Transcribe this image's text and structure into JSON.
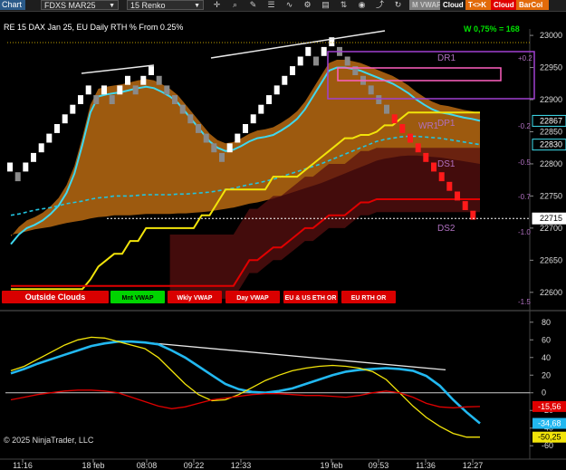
{
  "toolbar": {
    "chart_label": "Chart",
    "instrument": "FDXS MAR25",
    "interval": "15 Renko",
    "chips": [
      {
        "label": "M VWAP",
        "bg": "#7f7f7f",
        "fg": "#c8c8c8"
      },
      {
        "label": "Cloud",
        "bg": "#1e1e1e",
        "fg": "#ffffff"
      },
      {
        "label": "T<>K",
        "bg": "#e26b0a",
        "fg": "#ffffff"
      },
      {
        "label": "Cloud",
        "bg": "#e00000",
        "fg": "#ffffff"
      },
      {
        "label": "BarCol",
        "bg": "#e26b0a",
        "fg": "#ffffff"
      }
    ]
  },
  "header": {
    "title": "RE 15 DAX Jan 25, EU Daily RTH % From 0.25%",
    "wvalue": "W 0,75% = 168"
  },
  "copyright": "© 2025 NinjaTrader, LLC",
  "buttons": [
    {
      "label": "Outside Clouds",
      "color": "#d90000"
    },
    {
      "label": "Mnt VWAP",
      "color": "#00d400"
    },
    {
      "label": "Wkly VWAP",
      "color": "#d90000"
    },
    {
      "label": "Day VWAP",
      "color": "#d90000"
    },
    {
      "label": "EU & US ETH OR",
      "color": "#d90000"
    },
    {
      "label": "EU RTH OR",
      "color": "#d90000"
    }
  ],
  "zone_labels": [
    "DR1",
    "DP1",
    "WR1",
    "DS1",
    "DS2"
  ],
  "pct_labels": [
    "+0.2",
    "-0.2",
    "-0.5",
    "-0.7",
    "-1.0",
    "-1.5"
  ],
  "chart_data": [
    {
      "type": "line",
      "panel": "price",
      "y_ticks": [
        23000,
        22950,
        22900,
        22850,
        22800,
        22750,
        22700,
        22650,
        22600
      ],
      "ylim": [
        22580,
        23010
      ],
      "price_markers": [
        {
          "value": 22867,
          "label": "22867",
          "color": "#40e0f0"
        },
        {
          "value": 22830,
          "label": "22830",
          "color": "#40e0f0"
        },
        {
          "value": 22715,
          "label": "22715",
          "color": "#ffffff"
        }
      ],
      "bricks_up": [
        22795,
        22780,
        22795,
        22810,
        22825,
        22840,
        22855,
        22870,
        22885,
        22900,
        22915,
        22900,
        22915,
        22900,
        22915,
        22930,
        22915,
        22930,
        22945,
        22930,
        22915,
        22900,
        22885,
        22870,
        22855,
        22840,
        22825,
        22810,
        22825,
        22840,
        22855,
        22870,
        22885,
        22900,
        22915,
        22930,
        22945,
        22960,
        22975,
        22960,
        22975,
        22990,
        22975,
        22960,
        22945,
        22930,
        22915,
        22900,
        22885,
        22870,
        22855,
        22840,
        22825,
        22810,
        22795,
        22780,
        22765,
        22750,
        22735,
        22720
      ],
      "series": [
        {
          "name": "",
          "color": "#3fd8ee",
          "values": [
            22675,
            22690,
            22700,
            22705,
            22712,
            22722,
            22735,
            22755,
            22785,
            22830,
            22880,
            22905,
            22908,
            22910,
            22912,
            22915,
            22918,
            22920,
            22918,
            22912,
            22905,
            22895,
            22880,
            22865,
            22850,
            22835,
            22825,
            22820,
            22822,
            22828,
            22835,
            22840,
            22842,
            22845,
            22852,
            22860,
            22870,
            22885,
            22905,
            22925,
            22945,
            22950,
            22950,
            22948,
            22945,
            22940,
            22935,
            22930,
            22925,
            22918,
            22910,
            22900,
            22892,
            22885,
            22880,
            22878,
            22875,
            22872,
            22870,
            22867
          ]
        },
        {
          "name": "",
          "color": "#22c4e0",
          "values": [
            22720,
            22722,
            22725,
            22728,
            22730,
            22732,
            22735,
            22738,
            22740,
            22742,
            22745,
            22747,
            22748,
            22750,
            22750,
            22750,
            22751,
            22752,
            22752,
            22752,
            22752,
            22753,
            22753,
            22754,
            22755,
            22756,
            22758,
            22760,
            22762,
            22765,
            22768,
            22770,
            22773,
            22776,
            22780,
            22784,
            22788,
            22792,
            22796,
            22800,
            22805,
            22810,
            22815,
            22820,
            22825,
            22830,
            22835,
            22838,
            22840,
            22842,
            22843,
            22843,
            22842,
            22841,
            22840,
            22838,
            22836,
            22834,
            22832,
            22830
          ]
        },
        {
          "name": "",
          "color": "#f2e40a",
          "values": [
            22605,
            22605,
            22605,
            22605,
            22605,
            22605,
            22605,
            22605,
            22605,
            22605,
            22620,
            22640,
            22650,
            22660,
            22660,
            22680,
            22680,
            22700,
            22700,
            22700,
            22700,
            22700,
            22700,
            22700,
            22720,
            22720,
            22740,
            22760,
            22760,
            22760,
            22760,
            22760,
            22760,
            22780,
            22780,
            22780,
            22780,
            22790,
            22800,
            22810,
            22820,
            22830,
            22840,
            22840,
            22845,
            22845,
            22850,
            22860,
            22860,
            22870,
            22880,
            22880,
            22880,
            22880,
            22880,
            22880,
            22880,
            22880,
            22880,
            22880
          ]
        },
        {
          "name": "",
          "color": "#e00000",
          "values": [
            22610,
            22610,
            22610,
            22610,
            22610,
            22610,
            22610,
            22610,
            22610,
            22610,
            22610,
            22610,
            22610,
            22610,
            22610,
            22610,
            22610,
            22610,
            22610,
            22610,
            22610,
            22610,
            22610,
            22610,
            22610,
            22610,
            22610,
            22610,
            22610,
            22630,
            22650,
            22650,
            22660,
            22670,
            22670,
            22680,
            22690,
            22700,
            22700,
            22710,
            22720,
            22720,
            22720,
            22730,
            22740,
            22740,
            22745,
            22745,
            22745,
            22745,
            22745,
            22745,
            22745,
            22745,
            22745,
            22745,
            22745,
            22745,
            22745,
            22745
          ]
        }
      ]
    },
    {
      "type": "line",
      "panel": "oscillator",
      "y_ticks": [
        80,
        60,
        40,
        20,
        0,
        -20,
        -40,
        -60
      ],
      "ylim": [
        -68,
        88
      ],
      "value_markers": [
        {
          "value": -15.56,
          "label": "-15,56",
          "color": "#e00000"
        },
        {
          "value": -34.68,
          "label": "-34,68",
          "color": "#22b8f0"
        },
        {
          "value": -50.25,
          "label": "-50,25",
          "color": "#f2e40a"
        }
      ],
      "series": [
        {
          "name": "",
          "color": "#22b8f0",
          "values": [
            22,
            27,
            33,
            38,
            43,
            48,
            53,
            56,
            58,
            58,
            57,
            55,
            48,
            40,
            30,
            20,
            10,
            4,
            1,
            0,
            2,
            5,
            10,
            15,
            20,
            24,
            26,
            27,
            28,
            27,
            25,
            19,
            8,
            -8,
            -22,
            -34.68
          ]
        },
        {
          "name": "",
          "color": "#f2e40a",
          "values": [
            25,
            30,
            38,
            46,
            54,
            60,
            63,
            62,
            58,
            54,
            50,
            40,
            25,
            10,
            -2,
            -9,
            -8,
            -2,
            6,
            14,
            20,
            25,
            28,
            30,
            31,
            30,
            28,
            24,
            15,
            0,
            -15,
            -28,
            -38,
            -46,
            -50.25,
            -50.25
          ]
        },
        {
          "name": "",
          "color": "#e00000",
          "values": [
            -8,
            -5,
            -2,
            0,
            2,
            3,
            3,
            2,
            0,
            -5,
            -10,
            -15,
            -18,
            -16,
            -12,
            -8,
            -6,
            -4,
            -2,
            -1,
            -1,
            -2,
            -3,
            -3,
            -4,
            -5,
            -3,
            0,
            2,
            0,
            -5,
            -12,
            -16,
            -17,
            -16,
            -15.56
          ]
        }
      ]
    }
  ],
  "x_labels": [
    "11:16",
    "18 feb",
    "08:08",
    "09:22",
    "12:33",
    "19 feb",
    "09:53",
    "11:36",
    "12:27"
  ]
}
